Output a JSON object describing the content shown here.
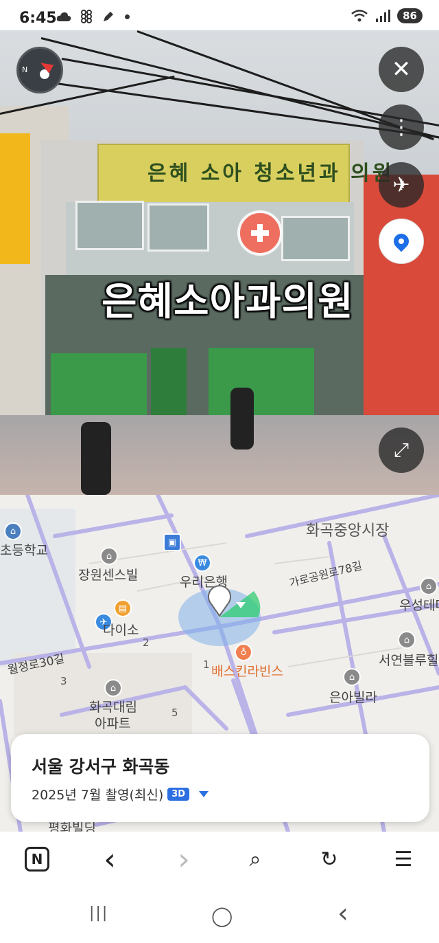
{
  "status_bar": {
    "time": "6:45",
    "battery": "86",
    "left_icons": [
      "cloud-icon",
      "grid-icon",
      "edit-icon",
      "dot-icon"
    ],
    "right_icons": [
      "wifi-icon",
      "signal-icon"
    ]
  },
  "streetview": {
    "place_overlay": "은혜소아과의원",
    "signboard_text": "은혜 소아 청소년과 의원"
  },
  "controls": {
    "close": "✕",
    "more": "⋮",
    "flight": "✈",
    "expand": "⤢"
  },
  "map": {
    "labels": {
      "market": "화곡중앙시장",
      "school": "초등학교",
      "jangwon": "장원센스빌",
      "woori": "우리은행",
      "daiso": "다이소",
      "gaggong": "가로공원로78길",
      "woosung": "우성테마",
      "seoyeon": "서연블루힐",
      "baskin": "배스킨라빈스",
      "eunvilla": "은아빌라",
      "wolgeong": "월정로30길",
      "hwagok_apt_1": "화곡대림",
      "hwagok_apt_2": "아파트",
      "pyeonghwa": "평화빌딩"
    },
    "numbers": [
      "2",
      "1",
      "3",
      "5"
    ]
  },
  "info_card": {
    "title": "서울 강서구 화곡동",
    "date": "2025년 7월 촬영(최신)",
    "badge": "3D"
  },
  "browser": {
    "home": "N",
    "back": "‹",
    "forward": "›",
    "search": "⌕",
    "reload": "↻",
    "menu": "☰"
  },
  "nav": {
    "recents": "|||",
    "home": "◯",
    "back": "‹"
  }
}
